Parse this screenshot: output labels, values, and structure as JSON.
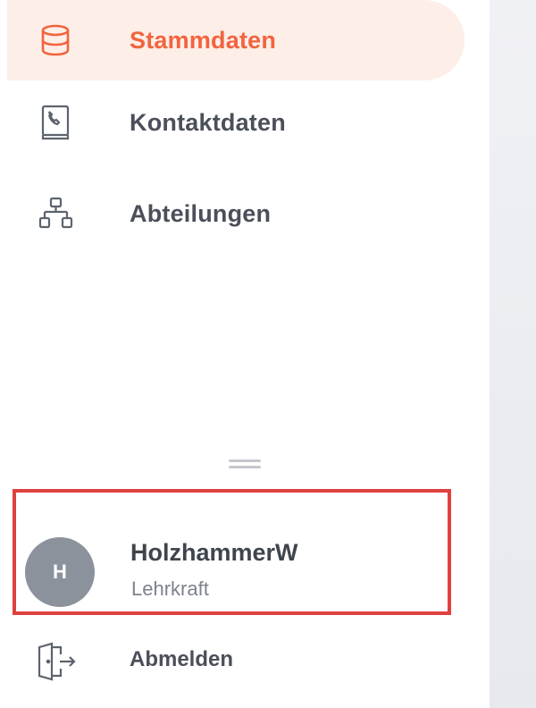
{
  "sidebar": {
    "items": [
      {
        "label": "Stammdaten",
        "icon": "database-icon",
        "active": true
      },
      {
        "label": "Kontaktdaten",
        "icon": "contact-book-icon",
        "active": false
      },
      {
        "label": "Abteilungen",
        "icon": "org-chart-icon",
        "active": false
      }
    ],
    "user": {
      "initial": "H",
      "name": "HolzhammerW",
      "role": "Lehrkraft"
    },
    "logout_label": "Abmelden"
  },
  "colors": {
    "accent": "#f2643e",
    "active_background": "#fdeee8",
    "text": "#4a4f59",
    "highlight_border": "#e0413f",
    "avatar": "#8b929c"
  }
}
